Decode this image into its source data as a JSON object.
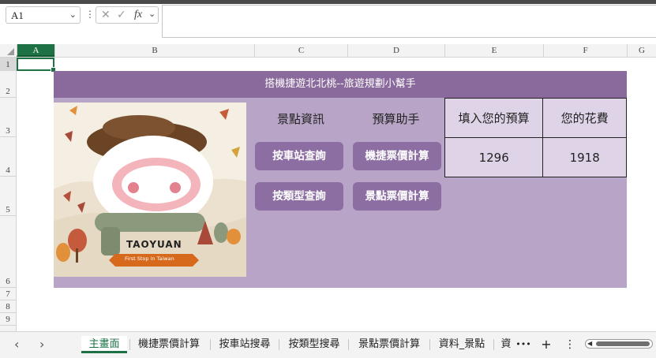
{
  "formula_bar": {
    "name_box": "A1",
    "cancel_icon": "✕",
    "enter_icon": "✓",
    "fx_label": "fx",
    "formula": ""
  },
  "columns": [
    "A",
    "B",
    "C",
    "D",
    "E",
    "F",
    "G"
  ],
  "rows": [
    "1",
    "2",
    "3",
    "4",
    "5",
    "6",
    "7",
    "8",
    "9"
  ],
  "sheet": {
    "title": "搭機捷遊北北桃--旅遊規劃小幫手",
    "image_caption": "TAOYUAN",
    "image_subcaption": "First Stop in Taiwan",
    "section_labels": {
      "attractions": "景點資訊",
      "budget_helper": "預算助手"
    },
    "buttons": {
      "by_station": "按車站查詢",
      "metro_fare": "機捷票價計算",
      "by_type": "按類型查詢",
      "attraction_fare": "景點票價計算"
    },
    "budget_table": {
      "headers": [
        "填入您的預算",
        "您的花費"
      ],
      "values": [
        "1296",
        "1918"
      ]
    }
  },
  "tabs": [
    {
      "label": "主畫面",
      "active": true
    },
    {
      "label": "機捷票價計算",
      "active": false
    },
    {
      "label": "按車站搜尋",
      "active": false
    },
    {
      "label": "按類型搜尋",
      "active": false
    },
    {
      "label": "景點票價計算",
      "active": false
    },
    {
      "label": "資料_景點",
      "active": false
    },
    {
      "label": "資",
      "active": false
    }
  ],
  "tab_overflow": "•••",
  "add_sheet": "+",
  "more": "⋮",
  "colors": {
    "accent": "#1e7145",
    "banner": "#8a6a9c",
    "panel": "#b7a4c6",
    "button": "#8d6ea3",
    "table": "#dfd4e7"
  }
}
